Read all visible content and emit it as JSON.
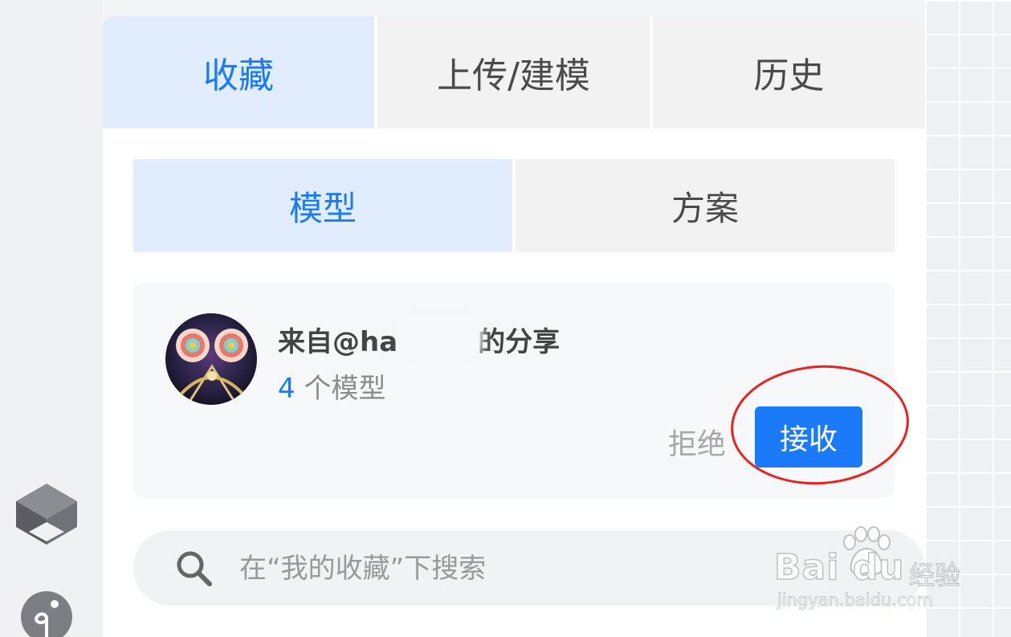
{
  "tabs": [
    {
      "label": "收藏",
      "active": true
    },
    {
      "label": "上传/建模",
      "active": false
    },
    {
      "label": "历史",
      "active": false
    }
  ],
  "subtabs": [
    {
      "label": "模型",
      "active": true
    },
    {
      "label": "方案",
      "active": false
    }
  ],
  "share_card": {
    "title_prefix": "来自@ha",
    "title_suffix": "的分享",
    "count": "4",
    "count_unit": "个模型",
    "reject_label": "拒绝",
    "accept_label": "接收"
  },
  "search": {
    "placeholder": "在“我的收藏”下搜索"
  },
  "sidebar": {
    "icons": [
      "box-icon",
      "plant-icon"
    ]
  },
  "watermark": {
    "brand": "Bai du",
    "cn": "经验",
    "url": "jingyan.baidu.com"
  },
  "colors": {
    "accent": "#1a7af8",
    "active_tab_bg": "#e1edfd",
    "annotation": "#e8231f"
  }
}
